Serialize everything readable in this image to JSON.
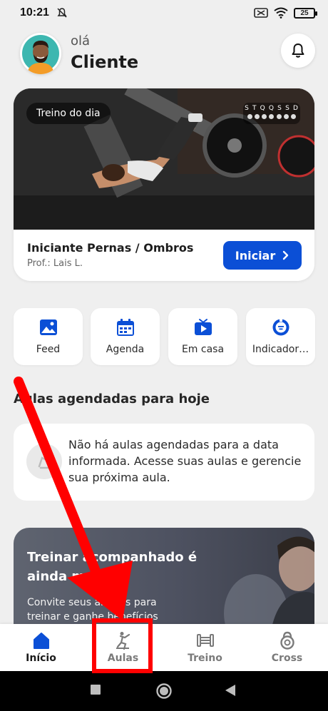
{
  "status_bar": {
    "time": "10:21",
    "battery": "25"
  },
  "header": {
    "greeting": "olá",
    "username": "Cliente"
  },
  "workout_card": {
    "chip": "Treino do dia",
    "week_days": [
      "S",
      "T",
      "Q",
      "Q",
      "S",
      "S",
      "D"
    ],
    "title": "Iniciante Pernas / Ombros",
    "professor": "Prof.: Lais L.",
    "start_label": "Iniciar"
  },
  "shortcuts": [
    {
      "label": "Feed",
      "icon": "image-icon"
    },
    {
      "label": "Agenda",
      "icon": "calendar-icon"
    },
    {
      "label": "Em casa",
      "icon": "tv-play-icon"
    },
    {
      "label": "Indicador…",
      "icon": "indicator-icon"
    }
  ],
  "classes_section": {
    "title": "Aulas agendadas para hoje",
    "empty_text": "Não há aulas agendadas para a data informada. Acesse suas aulas e gerencie sua próxima aula."
  },
  "promo": {
    "title": "Treinar acompanhado é ainda melhor!",
    "description": "Convite seus amigos para treinar e ganhe benefícios"
  },
  "bottom_nav": [
    {
      "label": "Início",
      "icon": "home-icon",
      "active": true
    },
    {
      "label": "Aulas",
      "icon": "exercise-icon",
      "active": false
    },
    {
      "label": "Treino",
      "icon": "dumbbell-icon",
      "active": false
    },
    {
      "label": "Cross",
      "icon": "kettlebell-icon",
      "active": false
    }
  ],
  "colors": {
    "accent": "#0b4fd6",
    "annotation": "#ff0000"
  }
}
